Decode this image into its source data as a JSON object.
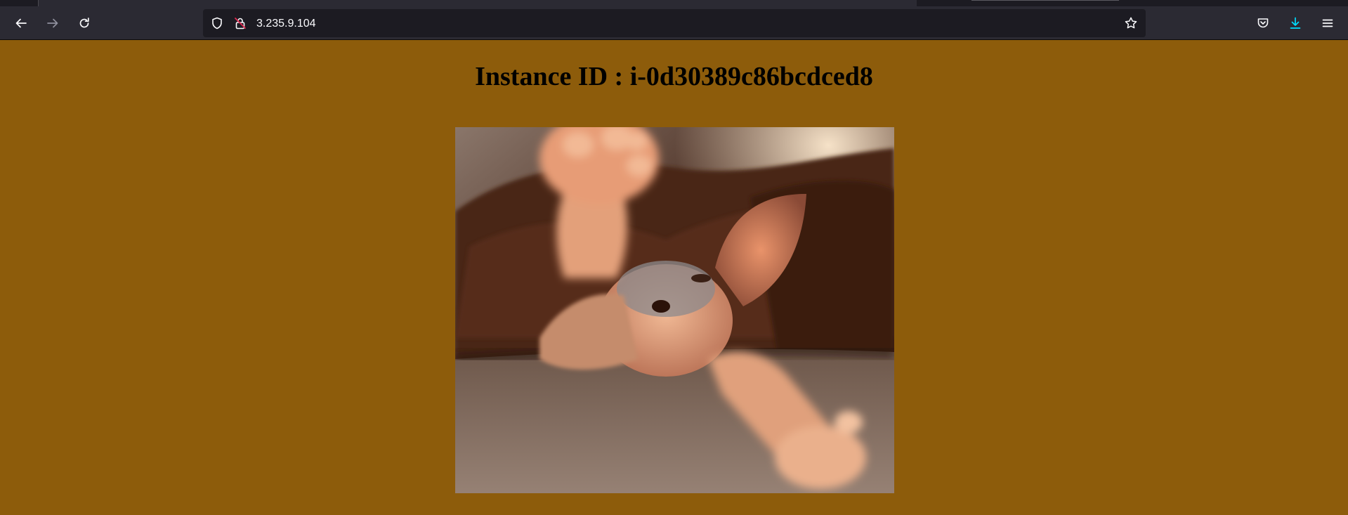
{
  "browser": {
    "url": "3.235.9.104",
    "icons": {
      "back": "arrow-left-icon",
      "forward": "arrow-right-icon",
      "reload": "reload-icon",
      "tracking_protection": "shield-icon",
      "connection": "insecure-lock-icon",
      "bookmark": "star-icon",
      "pocket": "pocket-icon",
      "downloads": "download-icon",
      "menu": "hamburger-menu-icon"
    },
    "colors": {
      "toolbar": "#2b2a33",
      "urlbar": "#1c1b22",
      "download_accent": "#00ddff"
    }
  },
  "page": {
    "title": "Instance ID : i-0d30389c86bcdced8",
    "background_color": "#8d5c0b",
    "image": {
      "description": "photo of a hairless Sphynx cat under a brown blanket reaching a paw toward the camera"
    }
  }
}
